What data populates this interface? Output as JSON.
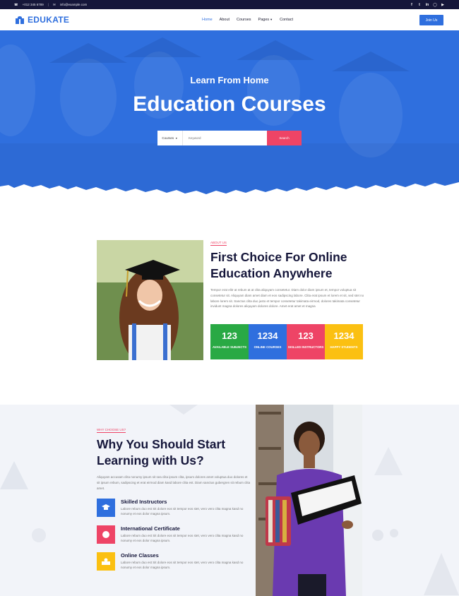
{
  "topbar": {
    "phone": "+012 345 6789",
    "email": "info@example.com",
    "social_icons": [
      "facebook-icon",
      "twitter-icon",
      "linkedin-icon",
      "instagram-icon",
      "youtube-icon"
    ]
  },
  "nav": {
    "brand": "EDUKATE",
    "items": [
      {
        "label": "Home",
        "active": true
      },
      {
        "label": "About",
        "active": false
      },
      {
        "label": "Courses",
        "active": false
      },
      {
        "label": "Pages",
        "active": false,
        "dropdown": true
      },
      {
        "label": "Contact",
        "active": false
      }
    ],
    "cta": "Join Us"
  },
  "hero": {
    "subtitle": "Learn From Home",
    "title": "Education Courses",
    "search": {
      "select_value": "Courses",
      "placeholder": "Keyword",
      "button": "Search"
    }
  },
  "about": {
    "label": "ABOUT US",
    "title": "First Choice For Online Education Anywhere",
    "body": "Tempor erat elitr at rebum at at clita aliquyam consetetur. Diam dolor diam ipsum et, tempor voluptua sit consetetur sit. Aliquyam diam amet diam et eos sadipscing labore. Clita erat ipsum et lorem et sit, sed stet no labore lorem sit. Sanctus clita duo justo et tempor consetetur takimata eirmod, dolores takimata consetetur invidunt magna dolores aliquyam dolores dolore. Amet erat amet et magna",
    "stats": [
      {
        "value": "123",
        "label": "Available Subjects",
        "color": "#29a944"
      },
      {
        "value": "1234",
        "label": "Online Courses",
        "color": "#2f6fde"
      },
      {
        "value": "123",
        "label": "Skilled Instructors",
        "color": "#ee4466"
      },
      {
        "value": "1234",
        "label": "Happy Students",
        "color": "#fbc012"
      }
    ]
  },
  "why": {
    "label": "WHY CHOOSE US?",
    "title": "Why You Should Start Learning with Us?",
    "body": "Aliquyam accusam clita nonumy ipsum sit sea clita ipsum clita, ipsum dolores amet voluptua duo dolores et sit ipsum rebum, sadipscing et erat eirmod diam kasd labore clita est. Diam sanctus gubergren sit rebum clita amet.",
    "features": [
      {
        "title": "Skilled Instructors",
        "text": "Labore rebum duo est Sit dolore eos sit tempor eos stet, vero vero clita magna kasd no nonumy et eos dolor magna ipsum.",
        "color": "#2f6fde",
        "icon": "graduation-cap-icon"
      },
      {
        "title": "International Certificate",
        "text": "Labore rebum duo est Sit dolore eos sit tempor eos stet, vero vero clita magna kasd no nonumy et eos dolor magna ipsum.",
        "color": "#ee4466",
        "icon": "certificate-icon"
      },
      {
        "title": "Online Classes",
        "text": "Labore rebum duo est Sit dolore eos sit tempor eos stet, vero vero clita magna kasd no nonumy et eos dolor magna ipsum.",
        "color": "#fbc012",
        "icon": "classroom-icon"
      }
    ]
  }
}
